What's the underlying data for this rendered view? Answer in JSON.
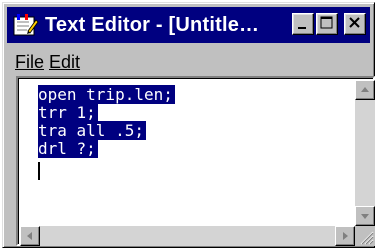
{
  "window": {
    "title": "Text Editor - [Untitle…"
  },
  "menu": {
    "file": "File",
    "edit": "Edit"
  },
  "editor": {
    "lines": [
      "open trip.len;",
      "trr 1;",
      "tra all .5;",
      "drl ?;"
    ]
  },
  "icons": {
    "app": "text-editor-icon",
    "minimize": "minimize-icon",
    "maximize": "maximize-icon",
    "close": "close-icon",
    "scroll_up": "arrow-up-icon",
    "scroll_down": "arrow-down-icon",
    "scroll_left": "arrow-left-icon",
    "scroll_right": "arrow-right-icon",
    "size_grip": "size-grip-icon"
  },
  "colors": {
    "titlebar": "#000080",
    "selection": "#000080",
    "chrome": "#c0c0c0"
  }
}
